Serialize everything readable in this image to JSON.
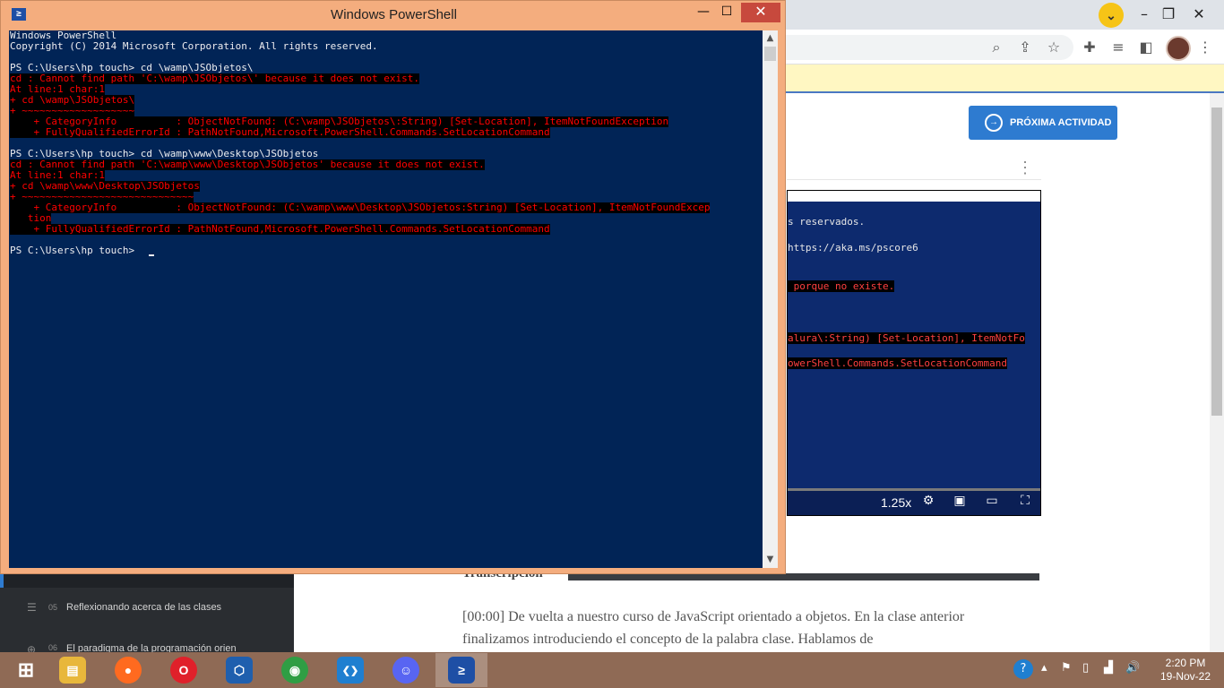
{
  "browser": {
    "profile_chevron": "⌄",
    "window_controls": {
      "minimize": "–",
      "maximize": "❐",
      "close": "✕"
    },
    "toolbar_icons": [
      "search-icon",
      "share-icon",
      "star-icon",
      "extensions-icon",
      "reading-list-icon",
      "side-panel-icon"
    ],
    "next_activity_label": "PRÓXIMA ACTIVIDAD",
    "kebab": "⋮"
  },
  "video": {
    "lines": [
      {
        "text": "s reservados.",
        "error": false
      },
      {
        "text": "https://aka.ms/pscore6",
        "error": false
      },
      {
        "text": " porque no existe.",
        "error": true
      },
      {
        "text": "alura\\:String) [Set-Location], ItemNotFo",
        "error": true
      },
      {
        "text": "owerShell.Commands.SetLocationCommand",
        "error": true
      }
    ],
    "speed": "1.25x",
    "controls": [
      "settings-icon",
      "miniplayer-icon",
      "theater-icon",
      "fullscreen-icon"
    ]
  },
  "sidebar": {
    "items": [
      {
        "num": "05",
        "label": "Reflexionando acerca de las clases"
      },
      {
        "num": "06",
        "label": "El paradigma de la programación orien"
      }
    ]
  },
  "transcript": {
    "title": "Transcripción",
    "text": "[00:00] De vuelta a nuestro curso de JavaScript orientado a objetos. En la clase anterior finalizamos introduciendo el concepto de la palabra clase. Hablamos de"
  },
  "powershell": {
    "title": "Windows PowerShell",
    "icon_glyph": "≥",
    "controls": {
      "minimize": "—",
      "maximize": "☐",
      "close": "✕"
    },
    "lines": [
      {
        "text": "Windows PowerShell",
        "error": false
      },
      {
        "text": "Copyright (C) 2014 Microsoft Corporation. All rights reserved.",
        "error": false
      },
      {
        "text": "",
        "error": false
      },
      {
        "text": "PS C:\\Users\\hp touch> cd \\wamp\\JSObjetos\\",
        "error": false
      },
      {
        "text": "cd : Cannot find path 'C:\\wamp\\JSObjetos\\' because it does not exist.",
        "error": true
      },
      {
        "text": "At line:1 char:1",
        "error": true
      },
      {
        "text": "+ cd \\wamp\\JSObjetos\\",
        "error": true
      },
      {
        "text": "+ ~~~~~~~~~~~~~~~~~~~",
        "error": true
      },
      {
        "text": "    + CategoryInfo          : ObjectNotFound: (C:\\wamp\\JSObjetos\\:String) [Set-Location], ItemNotFoundException",
        "error": true
      },
      {
        "text": "    + FullyQualifiedErrorId : PathNotFound,Microsoft.PowerShell.Commands.SetLocationCommand",
        "error": true
      },
      {
        "text": "",
        "error": false
      },
      {
        "text": "PS C:\\Users\\hp touch> cd \\wamp\\www\\Desktop\\JSObjetos",
        "error": false
      },
      {
        "text": "cd : Cannot find path 'C:\\wamp\\www\\Desktop\\JSObjetos' because it does not exist.",
        "error": true
      },
      {
        "text": "At line:1 char:1",
        "error": true
      },
      {
        "text": "+ cd \\wamp\\www\\Desktop\\JSObjetos",
        "error": true
      },
      {
        "text": "+ ~~~~~~~~~~~~~~~~~~~~~~~~~~~~~",
        "error": true
      },
      {
        "text": "    + CategoryInfo          : ObjectNotFound: (C:\\wamp\\www\\Desktop\\JSObjetos:String) [Set-Location], ItemNotFoundExcep",
        "error": true
      },
      {
        "text": "   tion",
        "error": true
      },
      {
        "text": "    + FullyQualifiedErrorId : PathNotFound,Microsoft.PowerShell.Commands.SetLocationCommand",
        "error": true
      },
      {
        "text": "",
        "error": false
      },
      {
        "text": "PS C:\\Users\\hp touch> ",
        "error": false
      }
    ]
  },
  "taskbar": {
    "apps": [
      {
        "name": "windows-start-icon",
        "glyph": "⊞",
        "color": "#ffffff"
      },
      {
        "name": "file-explorer-icon",
        "glyph": "▤",
        "color": "#e8b73b"
      },
      {
        "name": "firefox-icon",
        "glyph": "●",
        "color": "#ff6a1f"
      },
      {
        "name": "opera-icon",
        "glyph": "O",
        "color": "#e0202a"
      },
      {
        "name": "app-icon",
        "glyph": "⬡",
        "color": "#1f5fae"
      },
      {
        "name": "chrome-icon",
        "glyph": "◉",
        "color": "#2f9e44"
      },
      {
        "name": "vscode-icon",
        "glyph": "❮❯",
        "color": "#1f7fd0"
      },
      {
        "name": "discord-icon",
        "glyph": "☺",
        "color": "#5865f2"
      },
      {
        "name": "powershell-icon",
        "glyph": "≥",
        "color": "#1e4fa5"
      }
    ],
    "time": "2:20 PM",
    "date": "19-Nov-22"
  }
}
